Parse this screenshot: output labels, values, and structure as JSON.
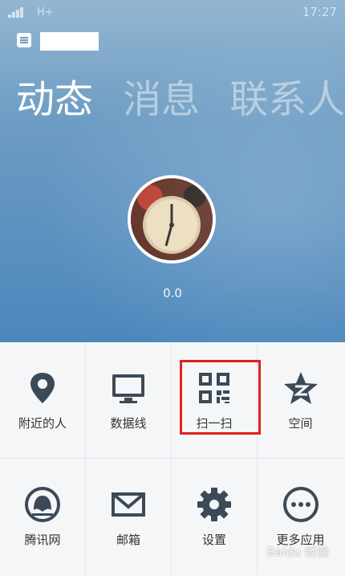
{
  "status_bar": {
    "network": "H+",
    "time": "17:27"
  },
  "tabs": [
    {
      "label": "动态",
      "active": true
    },
    {
      "label": "消息",
      "active": false
    },
    {
      "label": "联系人",
      "active": false
    }
  ],
  "profile": {
    "nickname": "0.0"
  },
  "grid": [
    {
      "label": "附近的人",
      "icon": "location-pin-icon"
    },
    {
      "label": "数据线",
      "icon": "monitor-icon"
    },
    {
      "label": "扫一扫",
      "icon": "qr-code-icon",
      "highlighted": true
    },
    {
      "label": "空间",
      "icon": "star-z-icon"
    },
    {
      "label": "腾讯网",
      "icon": "tencent-icon"
    },
    {
      "label": "邮箱",
      "icon": "mail-icon"
    },
    {
      "label": "设置",
      "icon": "gear-icon"
    },
    {
      "label": "更多应用",
      "icon": "more-dots-icon"
    }
  ],
  "watermark": "Baidu 经验",
  "colors": {
    "header": "#4b87bc",
    "icon": "#3c4a57",
    "highlight": "#e02020"
  }
}
